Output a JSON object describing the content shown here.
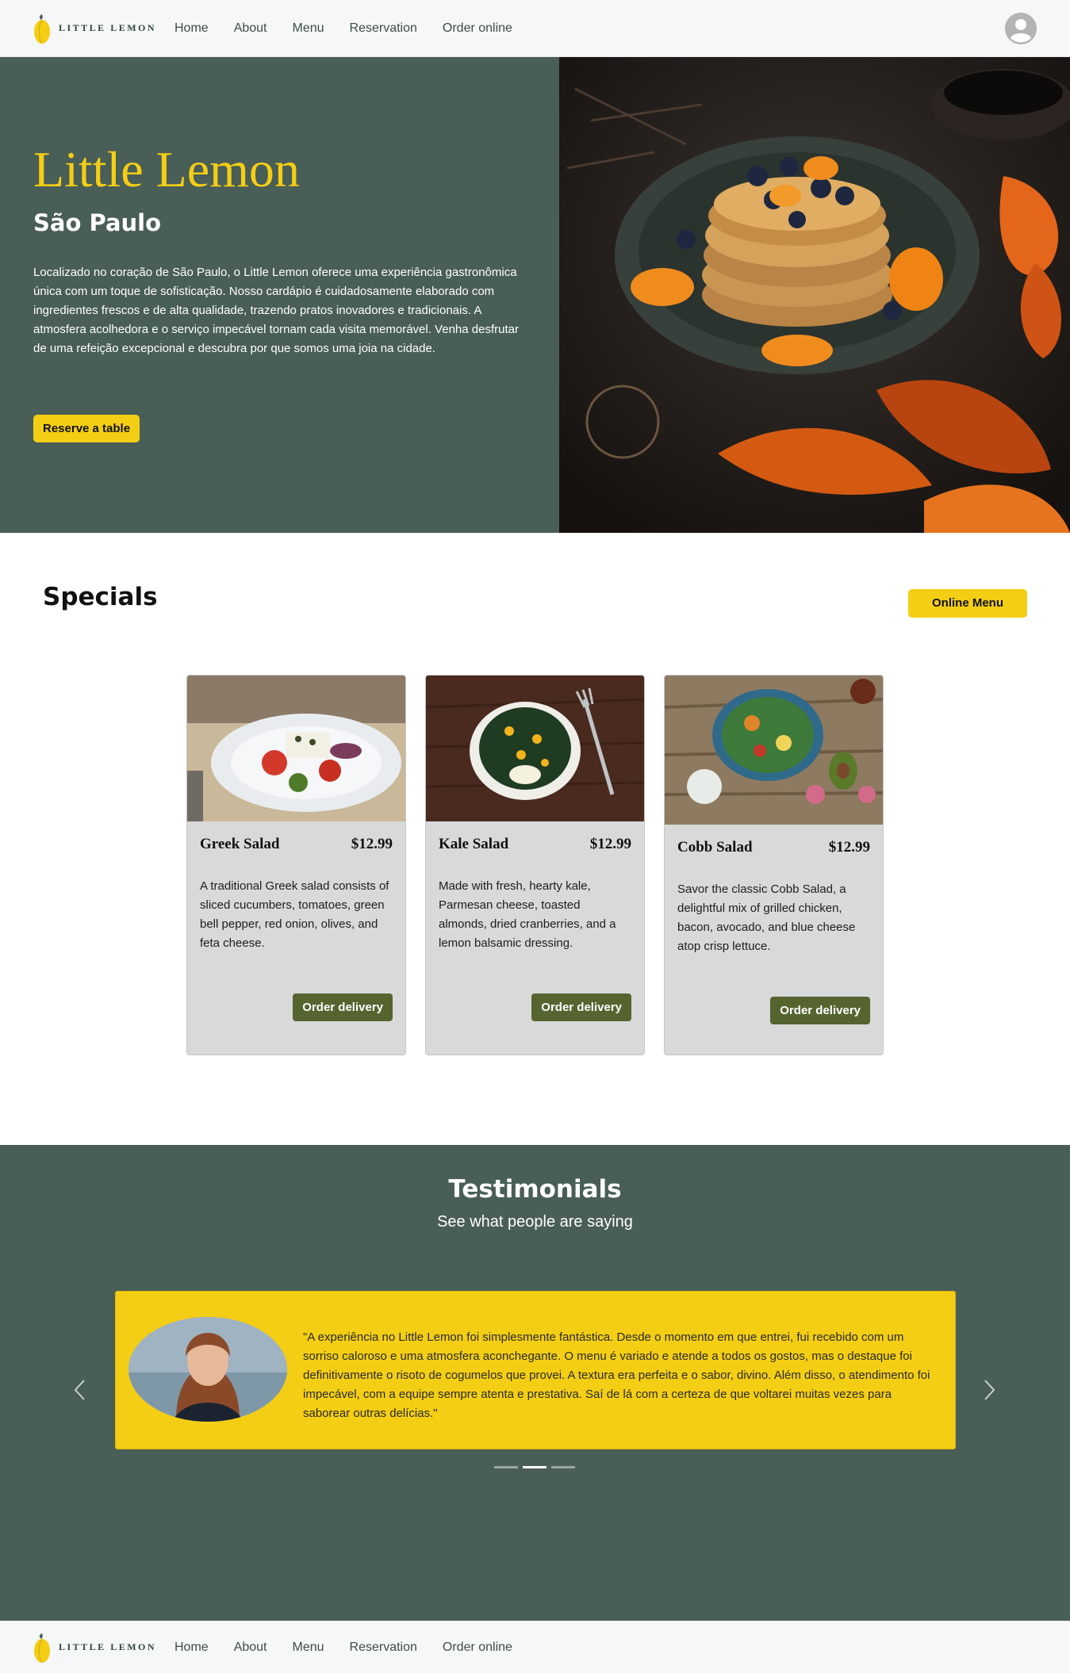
{
  "brand": {
    "logo_text": "LITTLE LEMON"
  },
  "nav": {
    "items": [
      {
        "label": "Home"
      },
      {
        "label": "About"
      },
      {
        "label": "Menu"
      },
      {
        "label": "Reservation"
      },
      {
        "label": "Order online"
      }
    ]
  },
  "hero": {
    "title": "Little Lemon",
    "subtitle": "São Paulo",
    "description": "Localizado no coração de São Paulo, o Little Lemon oferece uma experiência gastronômica única com um toque de sofisticação. Nosso cardápio é cuidadosamente elaborado com ingredientes frescos e de alta qualidade, trazendo pratos inovadores e tradicionais. A atmosfera acolhedora e o serviço impecável tornam cada visita memorável. Venha desfrutar de uma refeição excepcional e descubra por que somos uma joia na cidade.",
    "cta": "Reserve a table"
  },
  "specials": {
    "title": "Specials",
    "menu_button": "Online Menu",
    "cards": [
      {
        "name": "Greek Salad",
        "price": "$12.99",
        "description": "A traditional Greek salad consists of sliced cucumbers, tomatoes, green bell pepper, red onion, olives, and feta cheese.",
        "button": "Order delivery"
      },
      {
        "name": "Kale Salad",
        "price": "$12.99",
        "description": "Made with fresh, hearty kale, Parmesan cheese, toasted almonds, dried cranberries, and a lemon balsamic dressing.",
        "button": "Order delivery"
      },
      {
        "name": "Cobb Salad",
        "price": "$12.99",
        "description": "Savor the classic Cobb Salad, a delightful mix of grilled chicken, bacon, avocado, and blue cheese atop crisp lettuce.",
        "button": "Order delivery"
      }
    ]
  },
  "testimonials": {
    "title": "Testimonials",
    "subtitle": "See what people are saying",
    "quote": "\"A experiência no Little Lemon foi simplesmente fantástica. Desde o momento em que entrei, fui recebido com um sorriso caloroso e uma atmosfera aconchegante. O menu é variado e atende a todos os gostos, mas o destaque foi definitivamente o risoto de cogumelos que provei. A textura era perfeita e o sabor, divino. Além disso, o atendimento foi impecável, com a equipe sempre atenta e prestativa. Saí de lá com a certeza de que voltarei muitas vezes para saborear outras delícias.\"",
    "slide_count": 3,
    "active_slide": 2
  },
  "colors": {
    "primary_green": "#495e57",
    "primary_yellow": "#f4ce14",
    "button_green": "#56642f",
    "card_gray": "#d9d9d9"
  }
}
